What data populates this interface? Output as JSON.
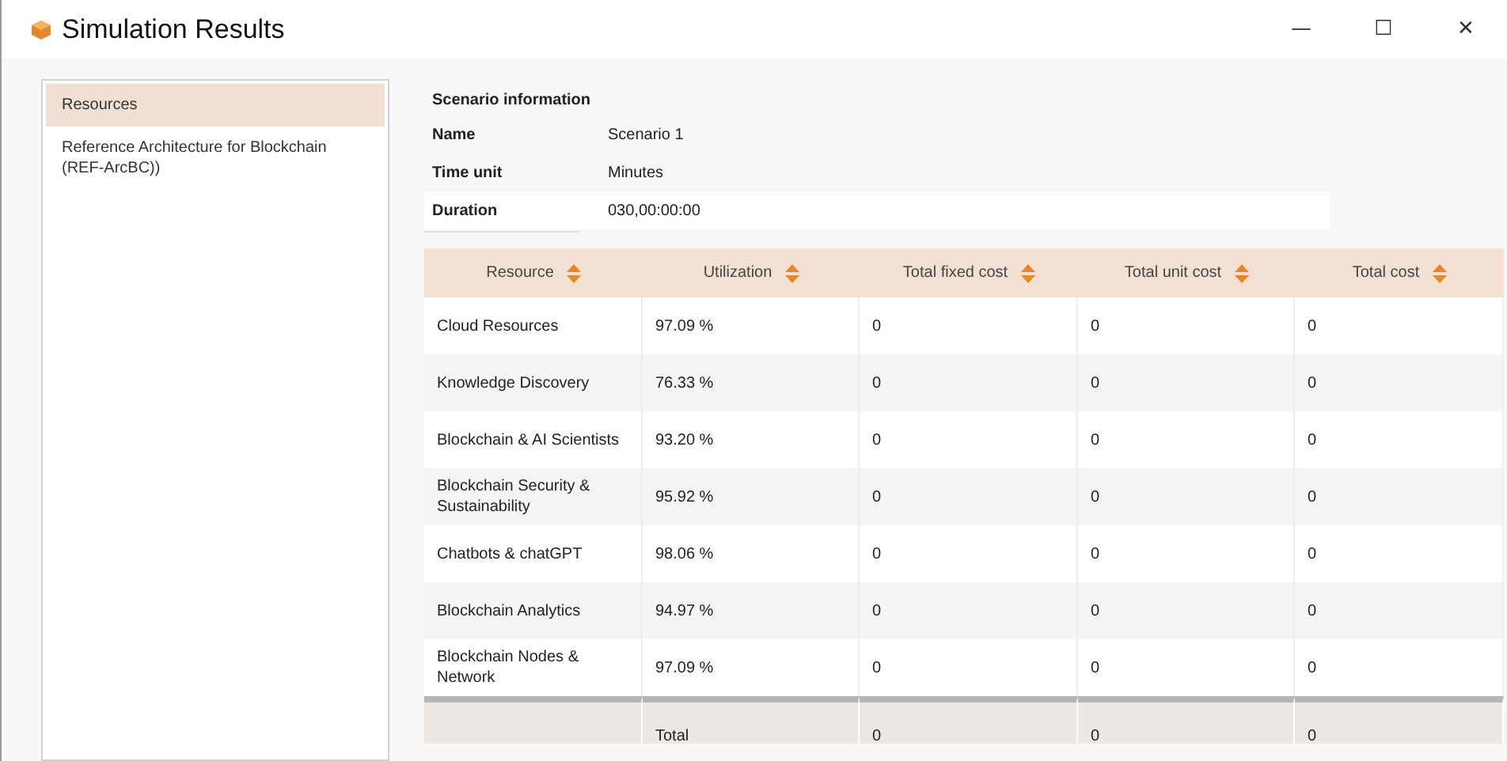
{
  "window": {
    "title": "Simulation Results",
    "controls": [
      "—",
      "☐",
      "✕"
    ]
  },
  "sidebar": {
    "items": [
      {
        "label": "Resources",
        "selected": true
      },
      {
        "label": "Reference Architecture for Blockchain (REF-ArcBC))",
        "selected": false
      }
    ]
  },
  "scenario": {
    "heading": "Scenario information",
    "fields": [
      {
        "label": "Name",
        "value": "Scenario 1"
      },
      {
        "label": "Time unit",
        "value": "Minutes"
      },
      {
        "label": "Duration",
        "value": "030,00:00:00"
      }
    ]
  },
  "table": {
    "columns": [
      "Resource",
      "Utilization",
      "Total fixed cost",
      "Total unit cost",
      "Total cost"
    ],
    "rows": [
      [
        "Cloud Resources",
        "97.09 %",
        "0",
        "0",
        "0"
      ],
      [
        "Knowledge Discovery",
        "76.33 %",
        "0",
        "0",
        "0"
      ],
      [
        "Blockchain & AI Scientists",
        "93.20 %",
        "0",
        "0",
        "0"
      ],
      [
        "Blockchain Security & Sustainability",
        "95.92 %",
        "0",
        "0",
        "0"
      ],
      [
        "Chatbots & chatGPT",
        "98.06 %",
        "0",
        "0",
        "0"
      ],
      [
        "Blockchain Analytics",
        "94.97 %",
        "0",
        "0",
        "0"
      ],
      [
        "Blockchain Nodes & Network",
        "97.09 %",
        "0",
        "0",
        "0"
      ]
    ],
    "footer": {
      "label": "Total",
      "values": [
        "0",
        "0",
        "0"
      ]
    }
  }
}
